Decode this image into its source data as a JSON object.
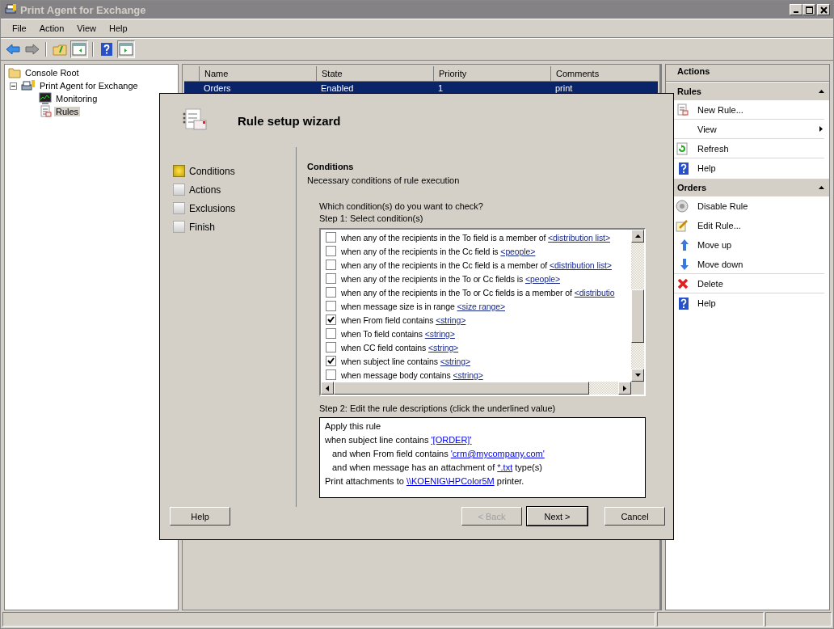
{
  "window": {
    "title": "Print Agent for Exchange"
  },
  "menu": [
    "File",
    "Action",
    "View",
    "Help"
  ],
  "tree": [
    {
      "label": "Console Root",
      "selected": false,
      "children": [
        {
          "label": "Print Agent for Exchange",
          "expanded": true,
          "selected": false,
          "children": [
            {
              "label": "Monitoring",
              "selected": false
            },
            {
              "label": "Rules",
              "selected": true
            }
          ]
        }
      ]
    }
  ],
  "table": {
    "columns": [
      "Name",
      "State",
      "Priority",
      "Comments"
    ],
    "rows": [
      {
        "cells": [
          "Orders",
          "Enabled",
          "1",
          "print"
        ],
        "selected": true
      }
    ]
  },
  "actions": {
    "title": "Actions",
    "sections": [
      {
        "title": "Rules",
        "items": [
          {
            "label": "New Rule...",
            "submenu": false,
            "divider_after": true
          },
          {
            "label": "View",
            "submenu": true,
            "divider_after": true
          },
          {
            "label": "Refresh",
            "submenu": false,
            "divider_after": true
          },
          {
            "label": "Help",
            "submenu": false,
            "divider_after": false
          }
        ]
      },
      {
        "title": "Orders",
        "items": [
          {
            "label": "Disable Rule",
            "submenu": false,
            "divider_after": false
          },
          {
            "label": "Edit Rule...",
            "submenu": false,
            "divider_after": false
          },
          {
            "label": "Move up",
            "submenu": false,
            "divider_after": false
          },
          {
            "label": "Move down",
            "submenu": false,
            "divider_after": true
          },
          {
            "label": "Delete",
            "submenu": false,
            "divider_after": true
          },
          {
            "label": "Help",
            "submenu": false,
            "divider_after": false
          }
        ]
      }
    ]
  },
  "dialog": {
    "title": "Rule setup wizard",
    "steps": [
      {
        "label": "Conditions",
        "selected": true
      },
      {
        "label": "Actions",
        "selected": false
      },
      {
        "label": "Exclusions",
        "selected": false
      },
      {
        "label": "Finish",
        "selected": false
      }
    ],
    "heading": "Conditions",
    "subheading": "Necessary conditions of rule execution",
    "question": "Which condition(s) do you want to check?",
    "step1": "Step 1: Select condition(s)",
    "conditions": [
      {
        "text": "when any of the recipients in the To field is  a member of",
        "link": "<distribution list>",
        "checked": false
      },
      {
        "text": "when any of the recipients in the Cc field is",
        "link": "<people>",
        "checked": false
      },
      {
        "text": "when any of the recipients in the Cc field is  a member of",
        "link": "<distribution list>",
        "checked": false
      },
      {
        "text": "when any of the recipients in the To or Cc fields is",
        "link": "<people>",
        "checked": false
      },
      {
        "text": "when any of the recipients in the To or Cc fields is  a member of",
        "link": "<distributio",
        "checked": false
      },
      {
        "text": "when message size is in range",
        "link": "<size range>",
        "checked": false
      },
      {
        "text": "when From field contains",
        "link": "<string>",
        "checked": true
      },
      {
        "text": "when To field contains",
        "link": "<string>",
        "checked": false
      },
      {
        "text": "when CC field contains",
        "link": "<string>",
        "checked": false
      },
      {
        "text": "when subject line contains",
        "link": "<string>",
        "checked": true
      },
      {
        "text": "when message body contains",
        "link": "<string>",
        "checked": false
      }
    ],
    "step2": "Step 2: Edit the rule descriptions (click the underlined value)",
    "description": [
      {
        "text": "Apply this rule",
        "indented": false
      },
      {
        "text": "when subject line contains",
        "link": "'[ORDER]'",
        "indented": false
      },
      {
        "text": "and  when From field contains",
        "link": "'crm@mycompany.com'",
        "indented": true
      },
      {
        "text": "and when message has an attachment of",
        "link": "*.txt",
        "after": "type(s)",
        "indented": true
      },
      {
        "text": "Print attachments to",
        "link": "\\\\KOENIG\\HPColor5M",
        "after": "printer.",
        "indented": false
      }
    ],
    "buttons": [
      {
        "label": "Help",
        "disabled": false,
        "default": false
      },
      {
        "label": "< Back",
        "disabled": true,
        "default": false
      },
      {
        "label": "Next >",
        "disabled": false,
        "default": true
      },
      {
        "label": "Cancel",
        "disabled": false,
        "default": false
      }
    ]
  }
}
